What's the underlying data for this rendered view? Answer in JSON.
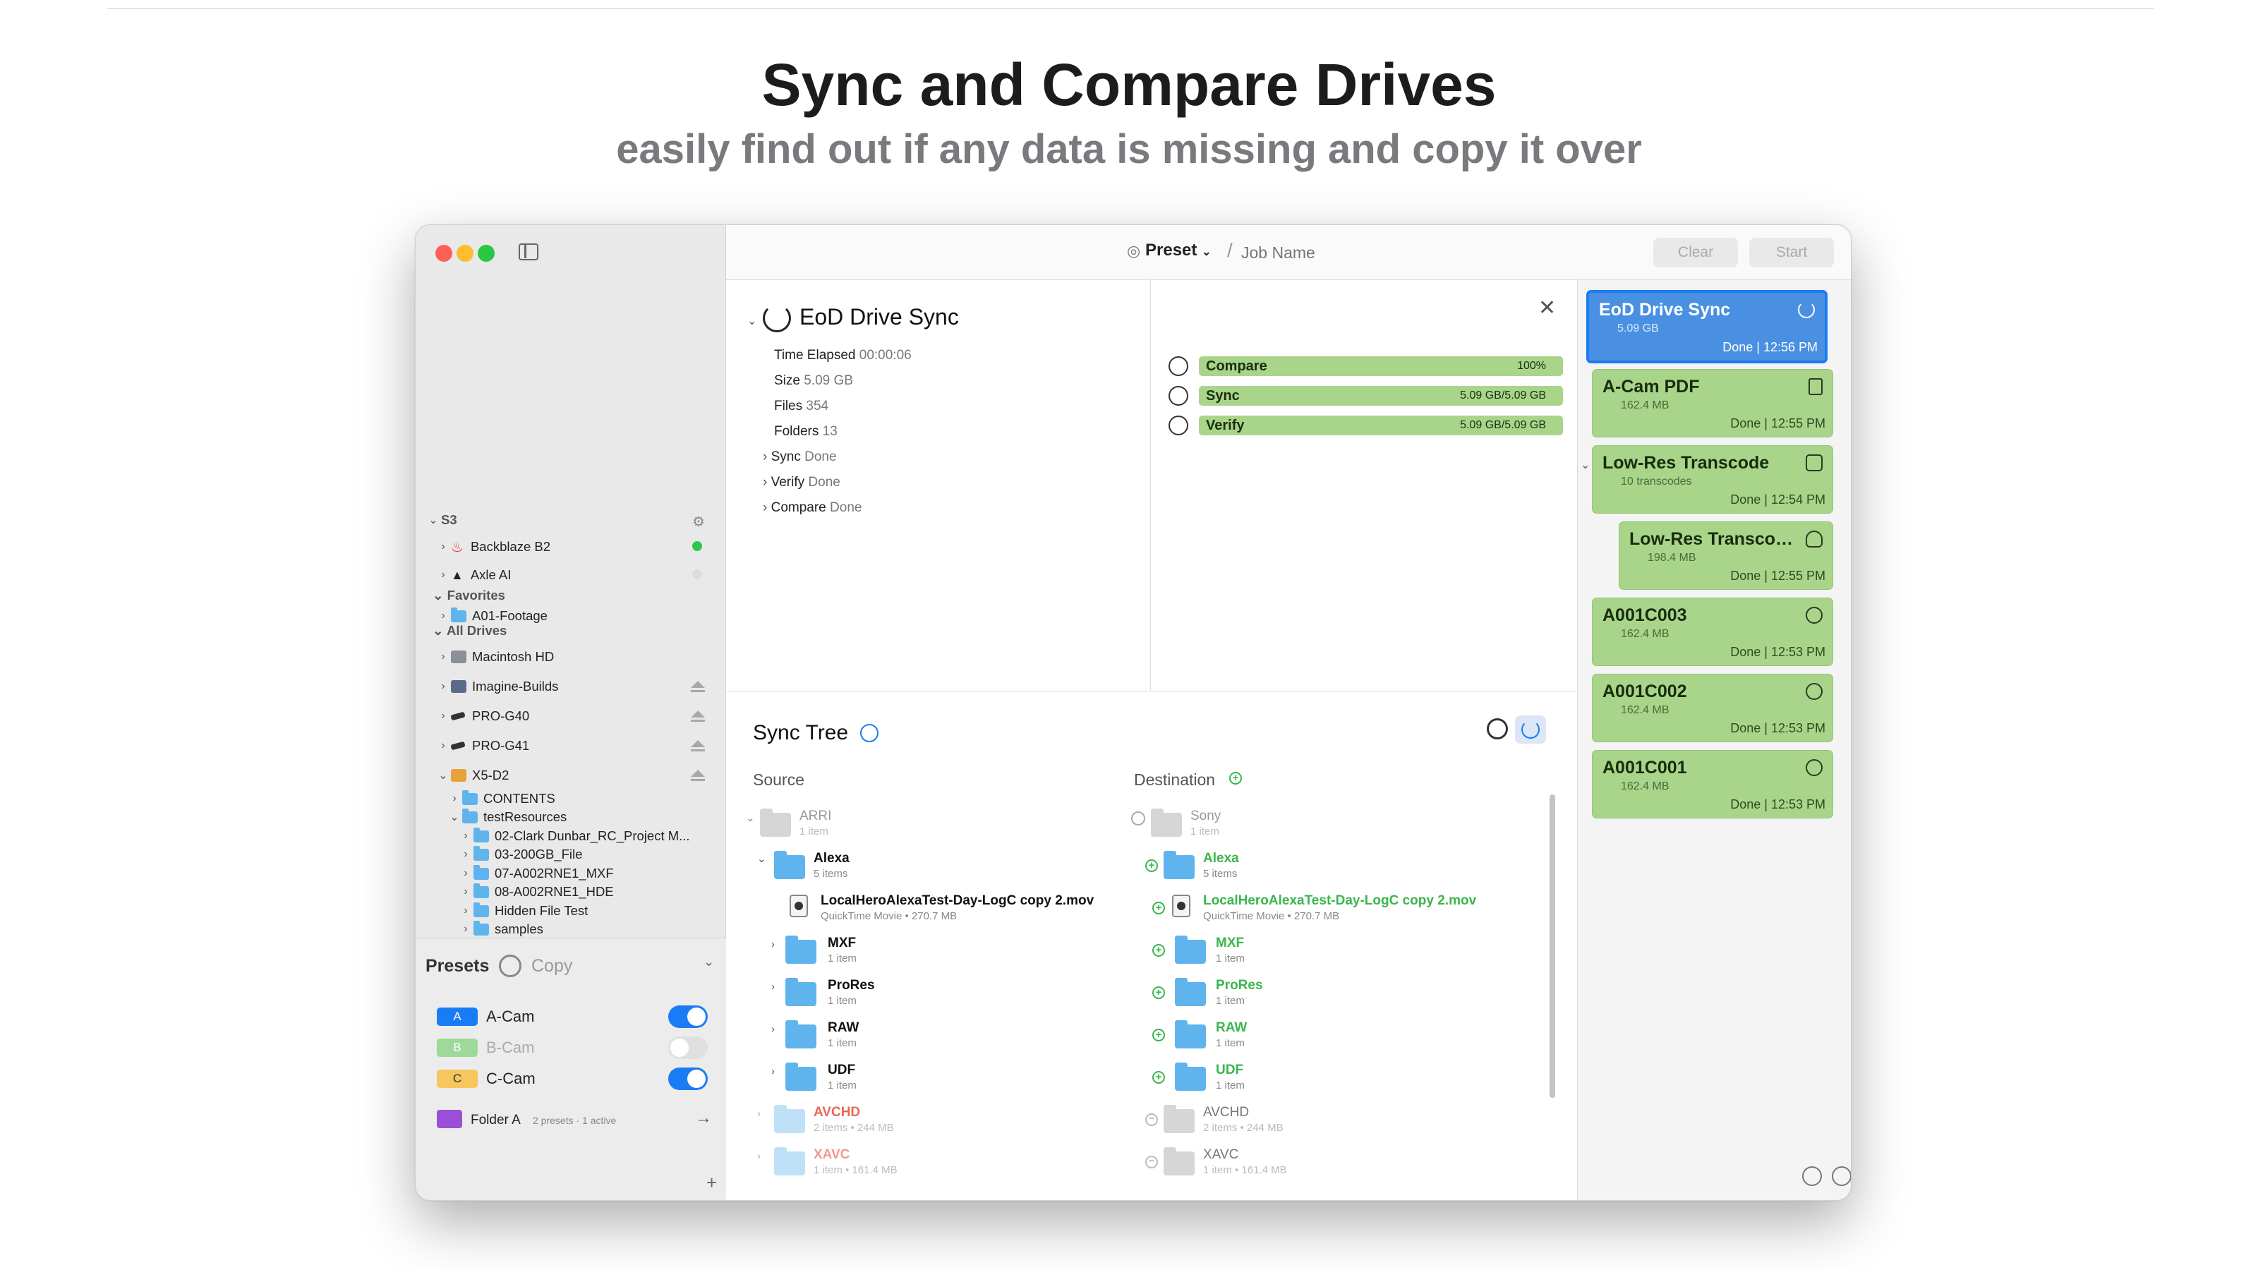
{
  "hero": {
    "title": "Sync and Compare Drives",
    "subtitle": "easily find out if any data is missing and copy it over"
  },
  "colors": {
    "accent": "#1a7cf5",
    "done_green": "#a9d58a",
    "active_blue": "#4a90e2",
    "add_green": "#3ab64e",
    "missing_red": "#e8675b"
  },
  "sidebar": {
    "s3_label": "S3",
    "s3_items": [
      {
        "label": "Backblaze B2",
        "status": "online"
      },
      {
        "label": "Axle AI",
        "status": "offline"
      }
    ],
    "favorites_label": "Favorites",
    "favorites": [
      {
        "label": "A01-Footage"
      }
    ],
    "all_drives_label": "All Drives",
    "drives": [
      {
        "label": "Macintosh HD"
      },
      {
        "label": "Imagine-Builds"
      },
      {
        "label": "PRO-G40"
      },
      {
        "label": "PRO-G41"
      },
      {
        "label": "X5-D2"
      }
    ],
    "x5_children": {
      "contents": "CONTENTS",
      "test_resources": "testResources",
      "test_children": [
        "02-Clark Dunbar_RC_Project M...",
        "03-200GB_File",
        "07-A002RNE1_MXF",
        "08-A002RNE1_HDE",
        "Hidden File Test",
        "samples"
      ]
    },
    "presets": {
      "title": "Presets",
      "mode": "Copy",
      "items": [
        {
          "badge": "A",
          "label": "A-Cam",
          "color": "#1a7cf5",
          "on": true
        },
        {
          "badge": "B",
          "label": "B-Cam",
          "color": "#8ed58b",
          "on": false
        },
        {
          "badge": "C",
          "label": "C-Cam",
          "color": "#f7c65c",
          "on": true
        }
      ],
      "folder": {
        "label": "Folder A",
        "meta": "2 presets · 1 active"
      },
      "add": "+"
    }
  },
  "toolbar": {
    "preset_label": "Preset",
    "slash": "/",
    "job_placeholder": "Job Name",
    "clear": "Clear",
    "start": "Start"
  },
  "job": {
    "title": "EoD Drive Sync",
    "stats": [
      {
        "k": "Time Elapsed",
        "v": "00:00:06"
      },
      {
        "k": "Size",
        "v": "5.09 GB"
      },
      {
        "k": "Files",
        "v": "354"
      },
      {
        "k": "Folders",
        "v": "13"
      }
    ],
    "steps": [
      {
        "k": "Sync",
        "v": "Done"
      },
      {
        "k": "Verify",
        "v": "Done"
      },
      {
        "k": "Compare",
        "v": "Done"
      }
    ],
    "progress": [
      {
        "label": "Compare",
        "value": "100%",
        "fraction": 1.0
      },
      {
        "label": "Sync",
        "value": "5.09 GB/5.09 GB",
        "fraction": 1.0
      },
      {
        "label": "Verify",
        "value": "5.09 GB/5.09 GB",
        "fraction": 1.0
      }
    ]
  },
  "queue": [
    {
      "title": "EoD Drive Sync",
      "sub": "5.09 GB",
      "status": "Done",
      "time": "12:56 PM",
      "active": true,
      "icon": "sync-icon"
    },
    {
      "title": "A-Cam PDF",
      "sub": "162.4 MB",
      "status": "Done",
      "time": "12:55 PM",
      "icon": "document-icon"
    },
    {
      "title": "Low-Res Transcode",
      "sub": "10 transcodes",
      "status": "Done",
      "time": "12:54 PM",
      "icon": "transcode-icon"
    },
    {
      "title": "Low-Res Transcod...",
      "sub": "198.4 MB",
      "status": "Done",
      "time": "12:55 PM",
      "icon": "upload-icon"
    },
    {
      "title": "A001C003",
      "sub": "162.4 MB",
      "status": "Done",
      "time": "12:53 PM",
      "icon": "circle-icon"
    },
    {
      "title": "A001C002",
      "sub": "162.4 MB",
      "status": "Done",
      "time": "12:53 PM",
      "icon": "circle-icon"
    },
    {
      "title": "A001C001",
      "sub": "162.4 MB",
      "status": "Done",
      "time": "12:53 PM",
      "icon": "circle-icon"
    }
  ],
  "synctree": {
    "title": "Sync Tree",
    "source_label": "Source",
    "dest_label": "Destination",
    "source": [
      {
        "name": "ARRI",
        "meta": "1 item",
        "kind": "root"
      },
      {
        "name": "Alexa",
        "meta": "5 items",
        "kind": "folder"
      },
      {
        "name": "LocalHeroAlexaTest-Day-LogC copy 2.mov",
        "meta": "QuickTime Movie • 270.7 MB",
        "kind": "file"
      },
      {
        "name": "MXF",
        "meta": "1 item",
        "kind": "folder"
      },
      {
        "name": "ProRes",
        "meta": "1 item",
        "kind": "folder"
      },
      {
        "name": "RAW",
        "meta": "1 item",
        "kind": "folder"
      },
      {
        "name": "UDF",
        "meta": "1 item",
        "kind": "folder"
      },
      {
        "name": "AVCHD",
        "meta": "2 items • 244 MB",
        "kind": "extra"
      },
      {
        "name": "XAVC",
        "meta": "1 item • 161.4 MB",
        "kind": "extra"
      }
    ],
    "dest": [
      {
        "name": "Sony",
        "meta": "1 item",
        "kind": "root"
      },
      {
        "name": "Alexa",
        "meta": "5 items",
        "kind": "add"
      },
      {
        "name": "LocalHeroAlexaTest-Day-LogC copy 2.mov",
        "meta": "QuickTime Movie • 270.7 MB",
        "kind": "addfile"
      },
      {
        "name": "MXF",
        "meta": "1 item",
        "kind": "add"
      },
      {
        "name": "ProRes",
        "meta": "1 item",
        "kind": "add"
      },
      {
        "name": "RAW",
        "meta": "1 item",
        "kind": "add"
      },
      {
        "name": "UDF",
        "meta": "1 item",
        "kind": "add"
      },
      {
        "name": "AVCHD",
        "meta": "2 items • 244 MB",
        "kind": "only"
      },
      {
        "name": "XAVC",
        "meta": "1 item • 161.4 MB",
        "kind": "only"
      }
    ]
  }
}
